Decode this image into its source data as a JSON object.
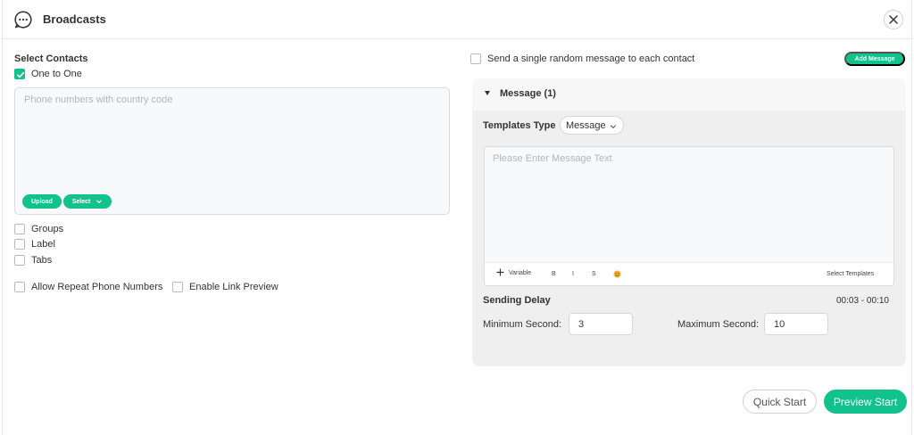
{
  "header": {
    "title": "Broadcasts",
    "icon": "chat-bubble-dots-icon",
    "close_icon": "close-icon"
  },
  "contacts": {
    "section_label": "Select Contacts",
    "one_to_one": {
      "label": "One to One",
      "checked": true
    },
    "phone_input": {
      "placeholder": "Phone numbers with country code",
      "value": ""
    },
    "upload_label": "Upload",
    "select_label": "Select",
    "options": [
      {
        "label": "Groups",
        "checked": false
      },
      {
        "label": "Label",
        "checked": false
      },
      {
        "label": "Tabs",
        "checked": false
      }
    ],
    "allow_repeat": {
      "label": "Allow Repeat Phone Numbers",
      "checked": false
    },
    "link_preview": {
      "label": "Enable Link Preview",
      "checked": false
    }
  },
  "message": {
    "random_message": {
      "label": "Send a single random message to each contact",
      "checked": false
    },
    "add_message_label": "Add Message",
    "panel_title": "Message (1)",
    "templates_type_label": "Templates Type",
    "templates_type_value": "Message",
    "text_input": {
      "placeholder": "Please Enter Message Text",
      "value": ""
    },
    "toolbar": {
      "variable_label": "Variable",
      "bold_label": "B",
      "italic_label": "I",
      "strike_label": "S",
      "select_templates_label": "Select Templates"
    },
    "sending_delay_label": "Sending Delay",
    "sending_delay_range": "00:03 - 00:10",
    "min_label": "Minimum Second",
    "min_value": "3",
    "max_label": "Maximum Second",
    "max_value": "10"
  },
  "footer": {
    "quick_start_label": "Quick Start",
    "preview_start_label": "Preview Start"
  },
  "colors": {
    "accent": "#12c28c",
    "panel_bg": "#efefef"
  }
}
